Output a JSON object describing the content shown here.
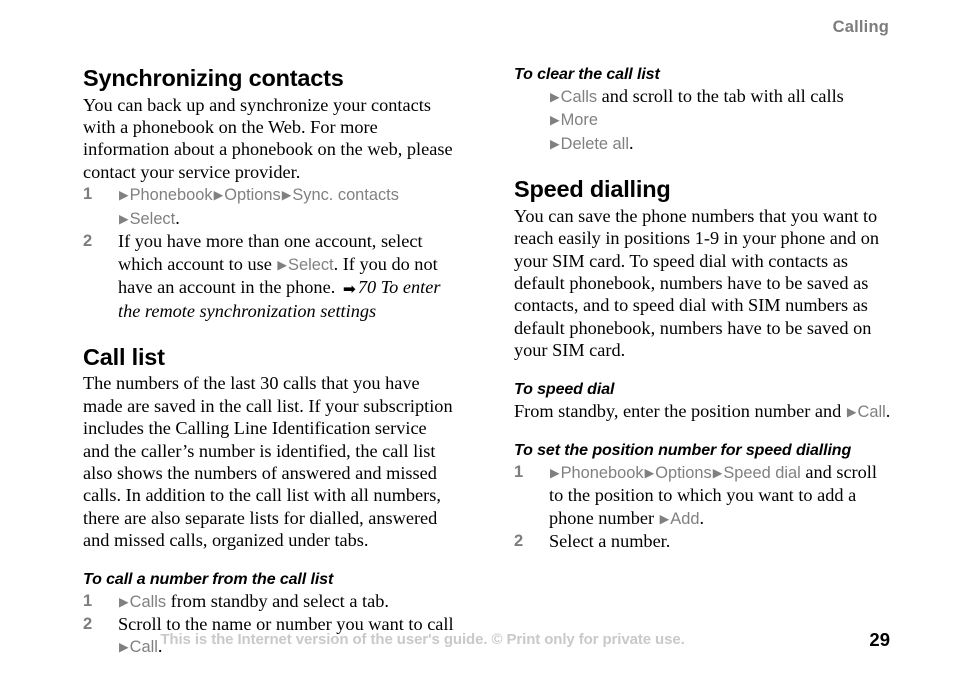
{
  "header": {
    "chapter": "Calling"
  },
  "symbols": {
    "ui_arrow": "▶",
    "xref_arrow": "➡"
  },
  "colors": {
    "ui_gray": "#808080",
    "header_gray": "#7d7d7d",
    "footer_gray": "#c9c9c9",
    "text_black": "#000000"
  },
  "left_column": {
    "sections": [
      {
        "type": "section",
        "title": "Synchronizing contacts",
        "paragraph": "You can back up and synchronize your contacts with a phonebook on the Web. For more information about a phonebook on the web, please contact your service provider.",
        "steps": [
          {
            "num": "1",
            "parts": [
              {
                "k": "arrow"
              },
              {
                "k": "ui",
                "t": "Phonebook"
              },
              {
                "k": "arrow"
              },
              {
                "k": "ui",
                "t": "Options"
              },
              {
                "k": "arrow"
              },
              {
                "k": "ui",
                "t": "Sync. contacts"
              },
              {
                "k": "br"
              },
              {
                "k": "arrow"
              },
              {
                "k": "ui",
                "t": "Select"
              },
              {
                "k": "plain",
                "t": "."
              }
            ]
          },
          {
            "num": "2",
            "parts": [
              {
                "k": "plain",
                "t": "If you have more than one account, select which account to use "
              },
              {
                "k": "arrow"
              },
              {
                "k": "ui",
                "t": "Select"
              },
              {
                "k": "plain",
                "t": ". If you do not have an account in the phone. "
              },
              {
                "k": "xrefarrow"
              },
              {
                "k": "xref",
                "t": "70 To enter the remote synchronization settings"
              }
            ]
          }
        ]
      },
      {
        "type": "section",
        "title": "Call list",
        "paragraph": "The numbers of the last 30 calls that you have made are saved in the call list. If your subscription includes the Calling Line Identification service and the caller’s number is identified, the call list also shows the numbers of answered and missed calls. In addition to the call list with all numbers, there are also separate lists for dialled, answered and missed calls, organized under tabs.",
        "subsections": [
          {
            "title": "To call a number from the call list",
            "steps": [
              {
                "num": "1",
                "parts": [
                  {
                    "k": "arrow"
                  },
                  {
                    "k": "ui",
                    "t": "Calls"
                  },
                  {
                    "k": "plain",
                    "t": " from standby and select a tab."
                  }
                ]
              },
              {
                "num": "2",
                "parts": [
                  {
                    "k": "plain",
                    "t": "Scroll to the name or number you want to call "
                  },
                  {
                    "k": "br"
                  },
                  {
                    "k": "arrow"
                  },
                  {
                    "k": "ui",
                    "t": "Call"
                  },
                  {
                    "k": "plain",
                    "t": "."
                  }
                ]
              }
            ]
          }
        ]
      }
    ]
  },
  "right_column": {
    "sections": [
      {
        "type": "subsection",
        "title": "To clear the call list",
        "plain_step": [
          {
            "k": "arrow"
          },
          {
            "k": "ui",
            "t": "Calls"
          },
          {
            "k": "plain",
            "t": " and scroll to the tab with all calls "
          },
          {
            "k": "arrow"
          },
          {
            "k": "ui",
            "t": "More"
          },
          {
            "k": "br"
          },
          {
            "k": "arrow"
          },
          {
            "k": "ui",
            "t": "Delete all"
          },
          {
            "k": "plain",
            "t": "."
          }
        ]
      },
      {
        "type": "section",
        "title": "Speed dialling",
        "paragraph": "You can save the phone numbers that you want to reach easily in positions 1-9 in your phone and on your SIM card. To speed dial with contacts as default phonebook, numbers have to be saved as contacts, and to speed dial with SIM numbers as default phonebook, numbers have to be saved on your SIM card.",
        "subsections": [
          {
            "title": "To speed dial",
            "plain_line": [
              {
                "k": "plain",
                "t": "From standby, enter the position number and "
              },
              {
                "k": "arrow"
              },
              {
                "k": "ui",
                "t": "Call"
              },
              {
                "k": "plain",
                "t": "."
              }
            ]
          },
          {
            "title": "To set the position number for speed dialling",
            "steps": [
              {
                "num": "1",
                "parts": [
                  {
                    "k": "arrow"
                  },
                  {
                    "k": "ui",
                    "t": "Phonebook"
                  },
                  {
                    "k": "arrow"
                  },
                  {
                    "k": "ui",
                    "t": "Options"
                  },
                  {
                    "k": "arrow"
                  },
                  {
                    "k": "ui",
                    "t": "Speed dial"
                  },
                  {
                    "k": "plain",
                    "t": " and scroll to the position to which you want to add a phone number "
                  },
                  {
                    "k": "arrow"
                  },
                  {
                    "k": "ui",
                    "t": "Add"
                  },
                  {
                    "k": "plain",
                    "t": "."
                  }
                ]
              },
              {
                "num": "2",
                "parts": [
                  {
                    "k": "plain",
                    "t": "Select a number."
                  }
                ]
              }
            ]
          }
        ]
      }
    ]
  },
  "footer": {
    "note": "This is the Internet version of the user's guide. © Print only for private use.",
    "page_number": "29"
  }
}
